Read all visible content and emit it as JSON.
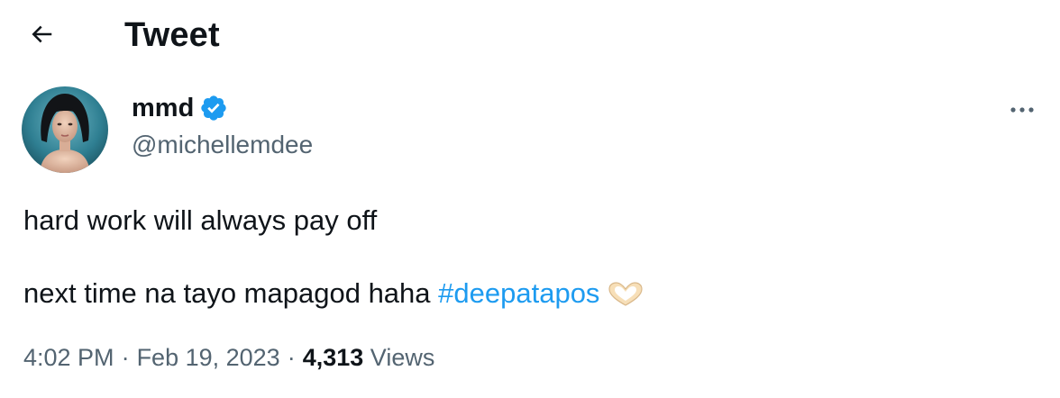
{
  "header": {
    "back_icon": "arrow-left-icon",
    "title": "Tweet"
  },
  "author": {
    "display_name": "mmd",
    "verified_icon": "verified-badge-icon",
    "verified_color": "#1d9bf0",
    "handle": "@michellemdee"
  },
  "more_icon": "more-horizontal-icon",
  "tweet": {
    "line1": "hard work will always pay off",
    "line2_text": "next time na tayo mapagod haha ",
    "hashtag": "#deepatapos",
    "hashtag_color": "#1d9bf0",
    "emoji_icon": "heart-hands-icon"
  },
  "meta": {
    "time": "4:02 PM",
    "separator": "·",
    "date": "Feb 19, 2023",
    "views_count": "4,313",
    "views_label": "Views"
  }
}
